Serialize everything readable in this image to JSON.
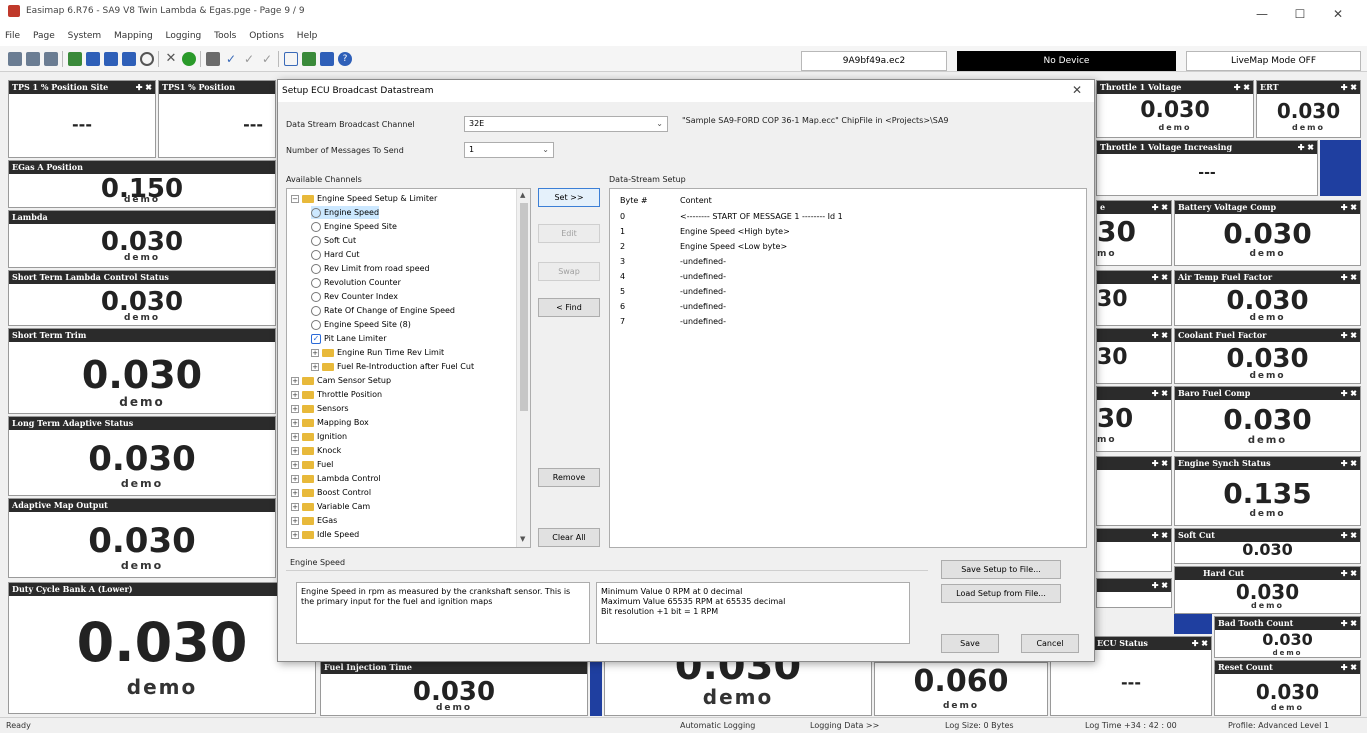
{
  "window": {
    "title": "Easimap 6.R76 - SA9 V8 Twin Lambda & Egas.pge - Page 9 / 9",
    "min": "—",
    "max": "☐",
    "close": "✕"
  },
  "menu": [
    "File",
    "Page",
    "System",
    "Mapping",
    "Logging",
    "Tools",
    "Options",
    "Help"
  ],
  "toolbar": {
    "file_label": "9A9bf49a.ec2",
    "device_label": "No Device",
    "livemap_label": "LiveMap Mode OFF",
    "colors": {
      "device_bg": "#000000",
      "device_fg": "#ffffff"
    }
  },
  "gauges": {
    "tps1_site": {
      "title": "TPS 1 % Position Site",
      "x": "✚ ✖",
      "value": "---"
    },
    "tps1_pos": {
      "title": "TPS1 % Position",
      "value": "---"
    },
    "egas": {
      "title": "EGas A Position",
      "value": "0.150",
      "demo": "demo"
    },
    "lambda": {
      "title": "Lambda",
      "value": "0.030",
      "demo": "demo"
    },
    "stlcs": {
      "title": "Short Term Lambda Control Status",
      "value": "0.030",
      "demo": "demo"
    },
    "stt": {
      "title": "Short Term Trim",
      "value": "0.030",
      "demo": "demo"
    },
    "ltas": {
      "title": "Long Term Adaptive Status",
      "value": "0.030",
      "demo": "demo"
    },
    "amo": {
      "title": "Adaptive Map Output",
      "value": "0.030",
      "demo": "demo"
    },
    "dcb": {
      "title": "Duty Cycle Bank A (Lower)",
      "value": "0.030",
      "demo": "demo"
    },
    "fuel_inj": {
      "title": "Fuel Injection Time",
      "value": "0.030",
      "demo": "demo"
    },
    "mid_bottom": {
      "value": "0.030",
      "demo": "demo"
    },
    "bottom_060": {
      "value": "0.060",
      "demo": "demo"
    },
    "ecu_status": {
      "title": "ECU Status",
      "x": "✚ ✖",
      "value": "---"
    },
    "throttle_v": {
      "title": "Throttle 1 Voltage",
      "x": "✚ ✖",
      "value": "0.030",
      "demo": "demo"
    },
    "ert": {
      "title": "ERT",
      "x": "✚ ✖",
      "value": "0.030",
      "demo": "demo"
    },
    "throttle_inc": {
      "title": "Throttle 1 Voltage Increasing",
      "x": "✚ ✖",
      "value": "---"
    },
    "batt": {
      "title": "Battery Voltage Comp",
      "x": "✚ ✖",
      "value": "0.030",
      "demo": "demo"
    },
    "airtemp": {
      "title": "Air Temp Fuel Factor",
      "x": "✚ ✖",
      "value": "0.030",
      "demo": "demo"
    },
    "coolant": {
      "title": "Coolant Fuel Factor",
      "x": "✚ ✖",
      "value": "0.030",
      "demo": "demo"
    },
    "baro": {
      "title": "Baro Fuel Comp",
      "x": "✚ ✖",
      "value": "0.030",
      "demo": "demo"
    },
    "synch": {
      "title": "Engine Synch Status",
      "x": "✚ ✖",
      "value": "0.135",
      "demo": "demo"
    },
    "softcut": {
      "title": "Soft Cut",
      "x": "✚ ✖",
      "value": "0.030",
      "demo": "demo"
    },
    "hardcut": {
      "title": "Hard Cut",
      "x": "✚ ✖",
      "value": "0.030",
      "demo": "demo"
    },
    "badtooth": {
      "title": "Bad Tooth Count",
      "x": "✚ ✖",
      "value": "0.030",
      "demo": "demo"
    },
    "reset": {
      "title": "Reset Count",
      "x": "✚ ✖",
      "value": "0.030",
      "demo": "demo"
    },
    "partial": {
      "v1": "30",
      "v2": "30",
      "v3": "30",
      "v4": "30",
      "demo": "mo",
      "hdr_e": "e",
      "x": "✚ ✖"
    }
  },
  "dialog": {
    "title": "Setup ECU Broadcast Datastream",
    "close": "✕",
    "channel_label": "Data Stream Broadcast Channel",
    "channel_value": "32E",
    "chipfile": "\"Sample SA9-FORD COP 36-1 Map.ecc\" ChipFile in <Projects>\\SA9",
    "messages_label": "Number of Messages To Send",
    "messages_value": "1",
    "available_label": "Available Channels",
    "setup_label": "Data-Stream Setup",
    "buttons": {
      "set": "Set >>",
      "edit": "Edit",
      "swap": "Swap",
      "find": "< Find",
      "remove": "Remove",
      "clear": "Clear All",
      "save_file": "Save Setup to File...",
      "load_file": "Load Setup from File...",
      "save": "Save",
      "cancel": "Cancel"
    },
    "tree": [
      {
        "label": "Engine Speed Setup & Limiter",
        "kind": "folder-open",
        "level": 0
      },
      {
        "label": "Engine Speed",
        "kind": "item",
        "level": 1
      },
      {
        "label": "Engine Speed Site",
        "kind": "item",
        "level": 1
      },
      {
        "label": "Soft Cut",
        "kind": "item",
        "level": 1
      },
      {
        "label": "Hard Cut",
        "kind": "item",
        "level": 1
      },
      {
        "label": "Rev Limit from road speed",
        "kind": "item",
        "level": 1
      },
      {
        "label": "Revolution Counter",
        "kind": "item",
        "level": 1
      },
      {
        "label": "Rev Counter Index",
        "kind": "item",
        "level": 1
      },
      {
        "label": "Rate Of Change of Engine Speed",
        "kind": "item",
        "level": 1
      },
      {
        "label": "Engine Speed Site (8)",
        "kind": "item",
        "level": 1
      },
      {
        "label": "Pit Lane Limiter",
        "kind": "check",
        "level": 1
      },
      {
        "label": "Engine Run Time Rev Limit",
        "kind": "folder",
        "level": 1
      },
      {
        "label": "Fuel Re-Introduction after Fuel Cut",
        "kind": "folder",
        "level": 1
      },
      {
        "label": "Cam Sensor Setup",
        "kind": "folder",
        "level": 0
      },
      {
        "label": "Throttle Position",
        "kind": "folder",
        "level": 0
      },
      {
        "label": "Sensors",
        "kind": "folder",
        "level": 0
      },
      {
        "label": "Mapping Box",
        "kind": "folder",
        "level": 0
      },
      {
        "label": "Ignition",
        "kind": "folder",
        "level": 0
      },
      {
        "label": "Knock",
        "kind": "folder",
        "level": 0
      },
      {
        "label": "Fuel",
        "kind": "folder",
        "level": 0
      },
      {
        "label": "Lambda Control",
        "kind": "folder",
        "level": 0
      },
      {
        "label": "Boost Control",
        "kind": "folder",
        "level": 0
      },
      {
        "label": "Variable Cam",
        "kind": "folder",
        "level": 0
      },
      {
        "label": "EGas",
        "kind": "folder",
        "level": 0
      },
      {
        "label": "Idle Speed",
        "kind": "folder",
        "level": 0
      }
    ],
    "ds_headers": {
      "byte": "Byte #",
      "content": "Content"
    },
    "ds_rows": [
      {
        "byte": "0",
        "content": "<-------- START OF MESSAGE 1 -------- Id 1"
      },
      {
        "byte": "1",
        "content": "Engine Speed <High byte>"
      },
      {
        "byte": "2",
        "content": "Engine Speed <Low byte>"
      },
      {
        "byte": "3",
        "content": "-undefined-"
      },
      {
        "byte": "4",
        "content": "-undefined-"
      },
      {
        "byte": "5",
        "content": "-undefined-"
      },
      {
        "byte": "6",
        "content": "-undefined-"
      },
      {
        "byte": "7",
        "content": "-undefined-"
      }
    ],
    "info_title": "Engine Speed",
    "info_desc": "Engine Speed in rpm as measured by the crankshaft sensor. This is the primary input for the fuel and ignition maps",
    "info_range": "Minimum Value 0 RPM at 0 decimal\nMaximum Value 65535 RPM at 65535 decimal\nBit resolution +1 bit = 1 RPM"
  },
  "status": {
    "ready": "Ready",
    "auto_log": "Automatic Logging",
    "log_data": "Logging Data >>",
    "log_size": "Log Size: 0 Bytes",
    "log_time": "Log Time +34 : 42 : 00",
    "profile": "Profile: Advanced Level 1"
  }
}
